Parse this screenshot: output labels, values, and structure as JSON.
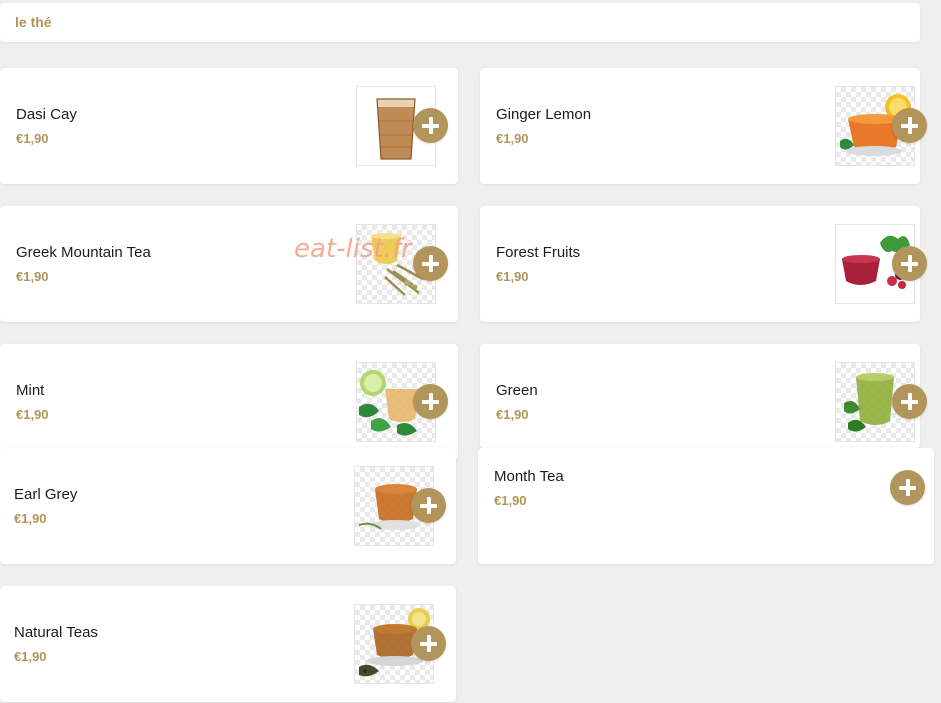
{
  "category": {
    "title": "le thé"
  },
  "items": [
    {
      "name": "Dasi Cay",
      "price": "€1,90",
      "image": "chai-glass-image"
    },
    {
      "name": "Ginger Lemon",
      "price": "€1,90",
      "image": "ginger-lemon-tea-image"
    },
    {
      "name": "Greek Mountain Tea",
      "price": "€1,90",
      "image": "greek-mountain-tea-image"
    },
    {
      "name": "Forest Fruits",
      "price": "€1,90",
      "image": "forest-fruits-tea-image"
    },
    {
      "name": "Mint",
      "price": "€1,90",
      "image": "mint-tea-image"
    },
    {
      "name": "Green",
      "price": "€1,90",
      "image": "green-tea-image"
    },
    {
      "name": "Earl Grey",
      "price": "€1,90",
      "image": "earl-grey-tea-image"
    },
    {
      "name": "Month Tea",
      "price": "€1,90",
      "image": null
    },
    {
      "name": "Natural Teas",
      "price": "€1,90",
      "image": "natural-teas-image"
    }
  ],
  "watermark": "eat-list.fr",
  "colors": {
    "accent": "#b1955a",
    "background": "#efefef",
    "card": "#ffffff",
    "watermark": "#f0a183"
  },
  "icons": {
    "add": "plus-circle-icon"
  }
}
